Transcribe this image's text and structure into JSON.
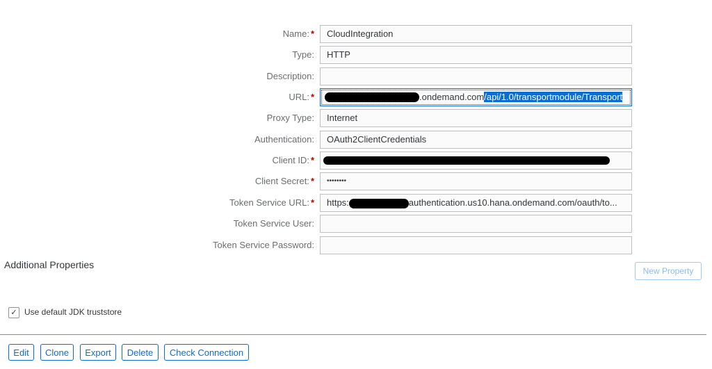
{
  "form": {
    "name": {
      "label": "Name:",
      "value": "CloudIntegration",
      "required": true
    },
    "type": {
      "label": "Type:",
      "value": "HTTP",
      "required": false
    },
    "description": {
      "label": "Description:",
      "value": "",
      "required": false
    },
    "url": {
      "label": "URL:",
      "value_visible": ".ondemand.com",
      "value_selected": "/api/1.0/transportmodule/Transport",
      "required": true
    },
    "proxy_type": {
      "label": "Proxy Type:",
      "value": "Internet",
      "required": false
    },
    "authentication": {
      "label": "Authentication:",
      "value": "OAuth2ClientCredentials",
      "required": false
    },
    "client_id": {
      "label": "Client ID:",
      "value": "",
      "required": true
    },
    "client_secret": {
      "label": "Client Secret:",
      "value": "••••••••",
      "required": true
    },
    "token_service_url": {
      "label": "Token Service URL:",
      "value_prefix": "https:",
      "value_visible": "authentication.us10.hana.ondemand.com/oauth/to...",
      "required": true
    },
    "token_service_user": {
      "label": "Token Service User:",
      "value": "",
      "required": false
    },
    "token_service_password": {
      "label": "Token Service Password:",
      "value": "",
      "required": false
    }
  },
  "additional_properties": {
    "title": "Additional Properties",
    "new_property_label": "New Property"
  },
  "truststore": {
    "label": "Use default JDK truststore",
    "checked": true,
    "check_glyph": "✓"
  },
  "footer": {
    "edit": "Edit",
    "clone": "Clone",
    "export": "Export",
    "delete": "Delete",
    "check_connection": "Check Connection"
  },
  "required_marker": "*",
  "colors": {
    "accent": "#0a6ed1",
    "required": "#bb0000"
  }
}
